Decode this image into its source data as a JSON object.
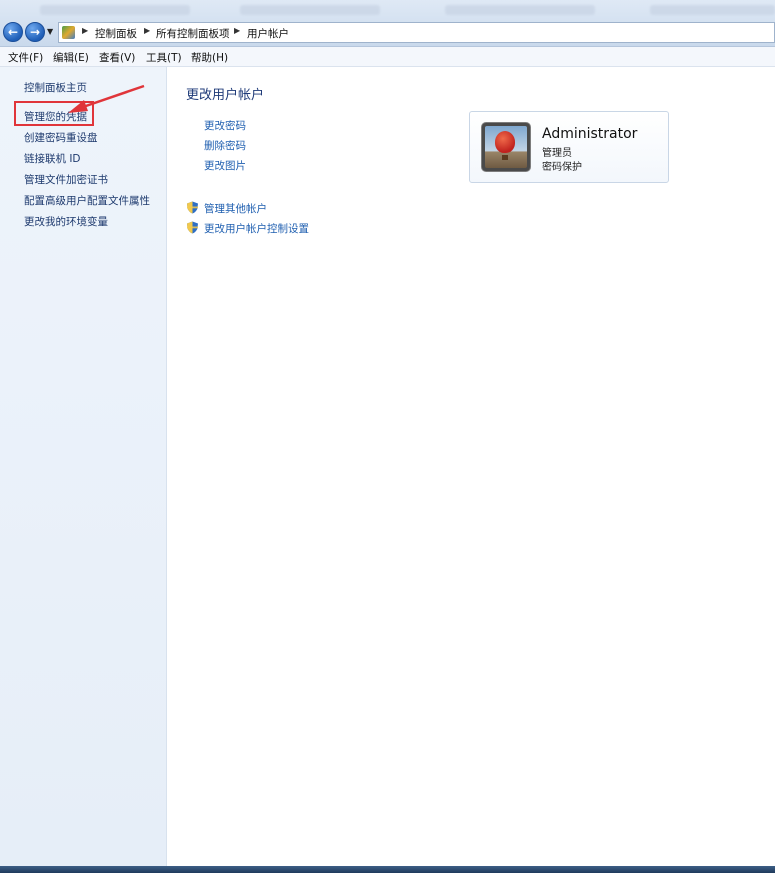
{
  "window": {
    "breadcrumbs": [
      "控制面板",
      "所有控制面板项",
      "用户帐户"
    ]
  },
  "menubar": {
    "items": [
      "文件(F)",
      "编辑(E)",
      "查看(V)",
      "工具(T)",
      "帮助(H)"
    ]
  },
  "sidebar": {
    "items": [
      "控制面板主页",
      "管理您的凭据",
      "创建密码重设盘",
      "链接联机 ID",
      "管理文件加密证书",
      "配置高级用户配置文件属性",
      "更改我的环境变量"
    ]
  },
  "main": {
    "title": "更改用户帐户",
    "links": [
      "更改密码",
      "删除密码",
      "更改图片"
    ],
    "shield_links": [
      "管理其他帐户",
      "更改用户帐户控制设置"
    ]
  },
  "account": {
    "name": "Administrator",
    "role": "管理员",
    "status": "密码保护"
  },
  "colors": {
    "highlight": "#e0353a",
    "link": "#1f5fb0"
  }
}
